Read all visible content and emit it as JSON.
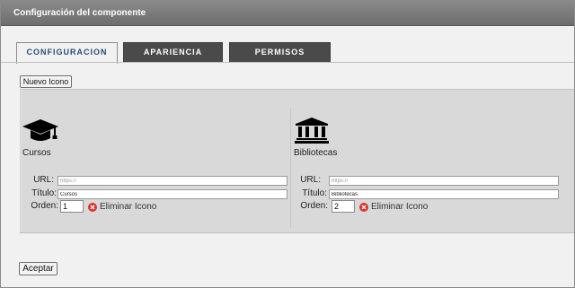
{
  "dialog": {
    "title": "Configuración del componente"
  },
  "tabs": [
    {
      "label": "CONFIGURACION",
      "active": true
    },
    {
      "label": "APARIENCIA",
      "active": false
    },
    {
      "label": "PERMISOS",
      "active": false
    }
  ],
  "toolbar": {
    "new_icon_label": "Nuevo Icono"
  },
  "form": {
    "labels": {
      "url": "URL:",
      "title": "Título:",
      "order": "Orden:"
    },
    "url_placeholder": "https://"
  },
  "icons": [
    {
      "icon": "graduation-cap-icon",
      "name": "Cursos",
      "url": "",
      "title": "Cursos",
      "order": "1",
      "delete_label": "Eliminar Icono"
    },
    {
      "icon": "library-icon",
      "name": "Bibliotecas",
      "url": "",
      "title": "Bibliotecas",
      "order": "2",
      "delete_label": "Eliminar Icono"
    }
  ],
  "footer": {
    "accept_label": "Aceptar"
  },
  "colors": {
    "titlebar": "#777777",
    "active_tab_text": "#2a4d78",
    "inactive_tab": "#4a4a4a",
    "panel": "#d9d9d9",
    "delete_icon": "#e0302a"
  }
}
